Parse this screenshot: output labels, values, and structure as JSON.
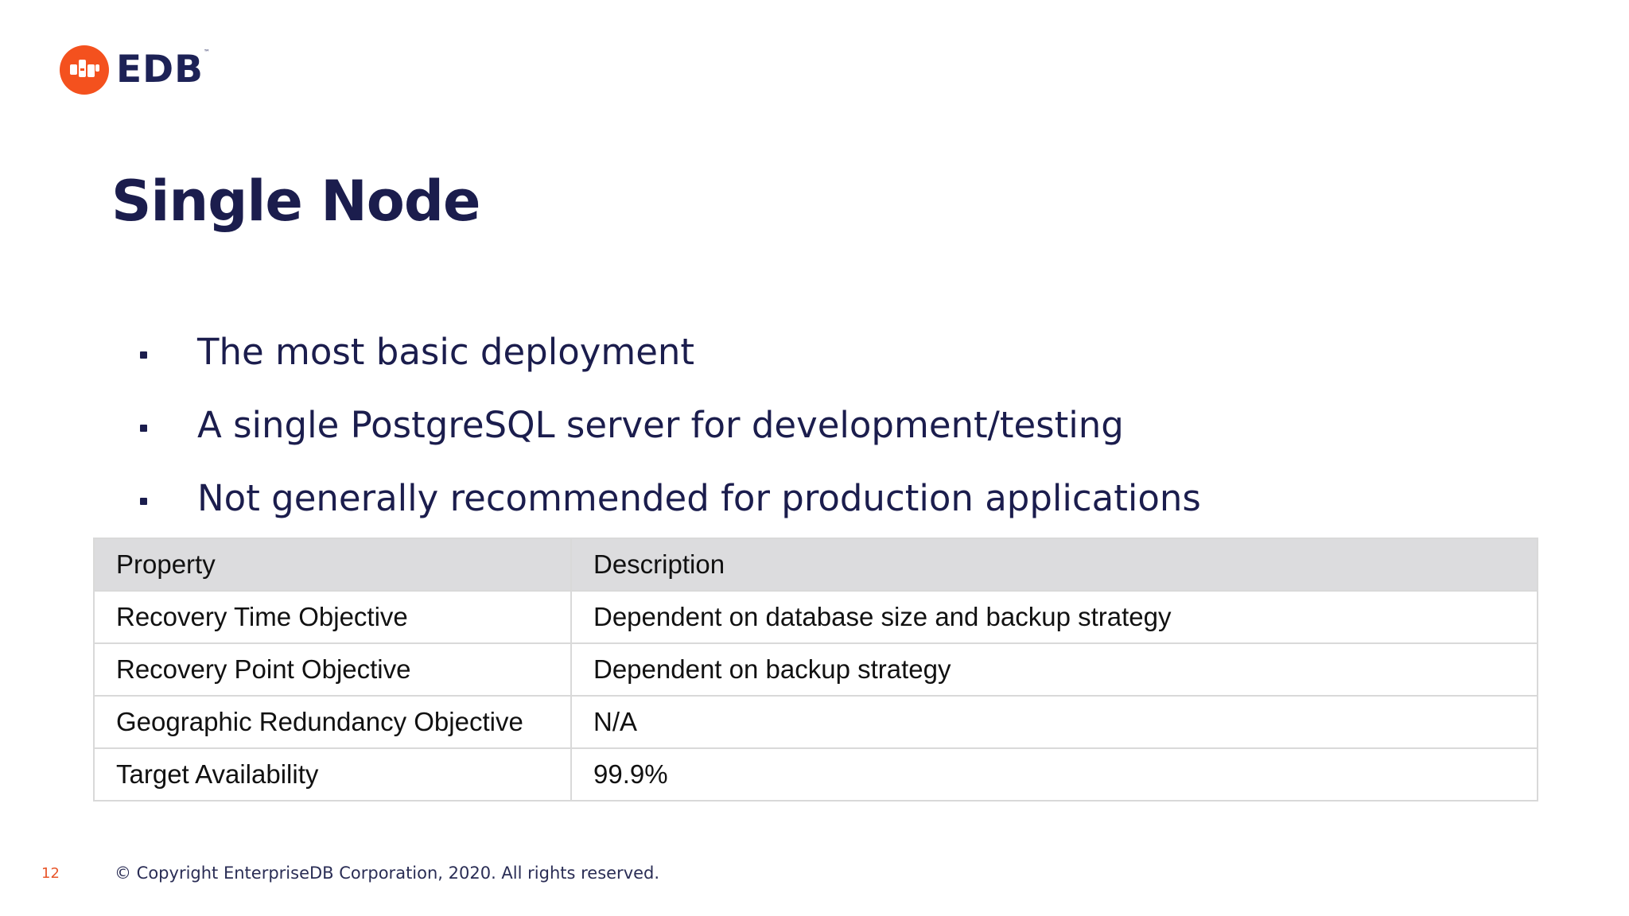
{
  "logo": {
    "wordmark": "EDB",
    "trademark": "™",
    "colors": {
      "mark": "#f4511e",
      "text": "#1d2256"
    }
  },
  "slide": {
    "title": "Single Node",
    "bullets": [
      "The most basic deployment",
      "A single PostgreSQL server for development/testing",
      "Not generally recommended for production applications"
    ]
  },
  "table": {
    "headers": [
      "Property",
      "Description"
    ],
    "rows": [
      [
        "Recovery Time Objective",
        "Dependent on database size and backup strategy"
      ],
      [
        "Recovery Point Objective",
        "Dependent on backup strategy"
      ],
      [
        "Geographic Redundancy Objective",
        "N/A"
      ],
      [
        "Target Availability",
        "99.9%"
      ]
    ]
  },
  "footer": {
    "page_number": "12",
    "copyright": "© Copyright EnterpriseDB Corporation, 2020. All rights reserved."
  },
  "colors": {
    "title": "#1b1d4d",
    "accent": "#e8562a",
    "table_header_bg": "#dcdcde",
    "table_border": "#d9d9d9"
  }
}
